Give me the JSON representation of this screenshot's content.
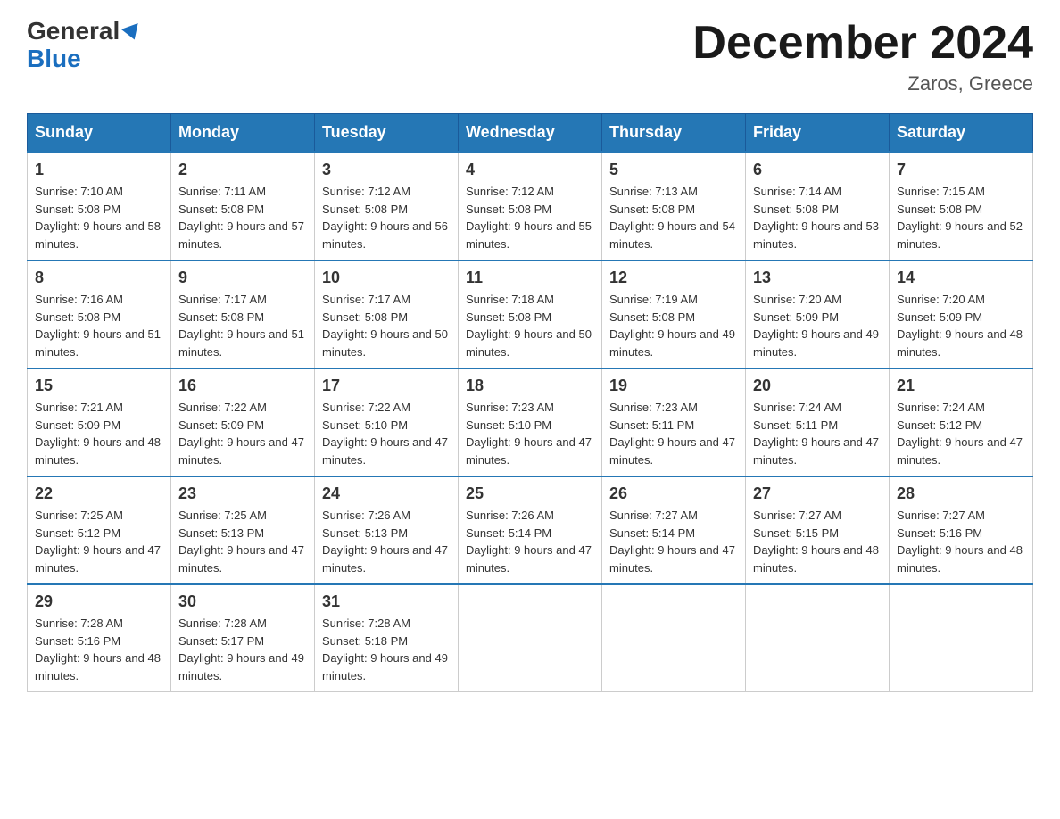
{
  "header": {
    "logo_line1": "General",
    "logo_line2": "Blue",
    "month_title": "December 2024",
    "location": "Zaros, Greece"
  },
  "days_of_week": [
    "Sunday",
    "Monday",
    "Tuesday",
    "Wednesday",
    "Thursday",
    "Friday",
    "Saturday"
  ],
  "weeks": [
    [
      {
        "day": "1",
        "sunrise": "7:10 AM",
        "sunset": "5:08 PM",
        "daylight": "9 hours and 58 minutes."
      },
      {
        "day": "2",
        "sunrise": "7:11 AM",
        "sunset": "5:08 PM",
        "daylight": "9 hours and 57 minutes."
      },
      {
        "day": "3",
        "sunrise": "7:12 AM",
        "sunset": "5:08 PM",
        "daylight": "9 hours and 56 minutes."
      },
      {
        "day": "4",
        "sunrise": "7:12 AM",
        "sunset": "5:08 PM",
        "daylight": "9 hours and 55 minutes."
      },
      {
        "day": "5",
        "sunrise": "7:13 AM",
        "sunset": "5:08 PM",
        "daylight": "9 hours and 54 minutes."
      },
      {
        "day": "6",
        "sunrise": "7:14 AM",
        "sunset": "5:08 PM",
        "daylight": "9 hours and 53 minutes."
      },
      {
        "day": "7",
        "sunrise": "7:15 AM",
        "sunset": "5:08 PM",
        "daylight": "9 hours and 52 minutes."
      }
    ],
    [
      {
        "day": "8",
        "sunrise": "7:16 AM",
        "sunset": "5:08 PM",
        "daylight": "9 hours and 51 minutes."
      },
      {
        "day": "9",
        "sunrise": "7:17 AM",
        "sunset": "5:08 PM",
        "daylight": "9 hours and 51 minutes."
      },
      {
        "day": "10",
        "sunrise": "7:17 AM",
        "sunset": "5:08 PM",
        "daylight": "9 hours and 50 minutes."
      },
      {
        "day": "11",
        "sunrise": "7:18 AM",
        "sunset": "5:08 PM",
        "daylight": "9 hours and 50 minutes."
      },
      {
        "day": "12",
        "sunrise": "7:19 AM",
        "sunset": "5:08 PM",
        "daylight": "9 hours and 49 minutes."
      },
      {
        "day": "13",
        "sunrise": "7:20 AM",
        "sunset": "5:09 PM",
        "daylight": "9 hours and 49 minutes."
      },
      {
        "day": "14",
        "sunrise": "7:20 AM",
        "sunset": "5:09 PM",
        "daylight": "9 hours and 48 minutes."
      }
    ],
    [
      {
        "day": "15",
        "sunrise": "7:21 AM",
        "sunset": "5:09 PM",
        "daylight": "9 hours and 48 minutes."
      },
      {
        "day": "16",
        "sunrise": "7:22 AM",
        "sunset": "5:09 PM",
        "daylight": "9 hours and 47 minutes."
      },
      {
        "day": "17",
        "sunrise": "7:22 AM",
        "sunset": "5:10 PM",
        "daylight": "9 hours and 47 minutes."
      },
      {
        "day": "18",
        "sunrise": "7:23 AM",
        "sunset": "5:10 PM",
        "daylight": "9 hours and 47 minutes."
      },
      {
        "day": "19",
        "sunrise": "7:23 AM",
        "sunset": "5:11 PM",
        "daylight": "9 hours and 47 minutes."
      },
      {
        "day": "20",
        "sunrise": "7:24 AM",
        "sunset": "5:11 PM",
        "daylight": "9 hours and 47 minutes."
      },
      {
        "day": "21",
        "sunrise": "7:24 AM",
        "sunset": "5:12 PM",
        "daylight": "9 hours and 47 minutes."
      }
    ],
    [
      {
        "day": "22",
        "sunrise": "7:25 AM",
        "sunset": "5:12 PM",
        "daylight": "9 hours and 47 minutes."
      },
      {
        "day": "23",
        "sunrise": "7:25 AM",
        "sunset": "5:13 PM",
        "daylight": "9 hours and 47 minutes."
      },
      {
        "day": "24",
        "sunrise": "7:26 AM",
        "sunset": "5:13 PM",
        "daylight": "9 hours and 47 minutes."
      },
      {
        "day": "25",
        "sunrise": "7:26 AM",
        "sunset": "5:14 PM",
        "daylight": "9 hours and 47 minutes."
      },
      {
        "day": "26",
        "sunrise": "7:27 AM",
        "sunset": "5:14 PM",
        "daylight": "9 hours and 47 minutes."
      },
      {
        "day": "27",
        "sunrise": "7:27 AM",
        "sunset": "5:15 PM",
        "daylight": "9 hours and 48 minutes."
      },
      {
        "day": "28",
        "sunrise": "7:27 AM",
        "sunset": "5:16 PM",
        "daylight": "9 hours and 48 minutes."
      }
    ],
    [
      {
        "day": "29",
        "sunrise": "7:28 AM",
        "sunset": "5:16 PM",
        "daylight": "9 hours and 48 minutes."
      },
      {
        "day": "30",
        "sunrise": "7:28 AM",
        "sunset": "5:17 PM",
        "daylight": "9 hours and 49 minutes."
      },
      {
        "day": "31",
        "sunrise": "7:28 AM",
        "sunset": "5:18 PM",
        "daylight": "9 hours and 49 minutes."
      },
      null,
      null,
      null,
      null
    ]
  ]
}
